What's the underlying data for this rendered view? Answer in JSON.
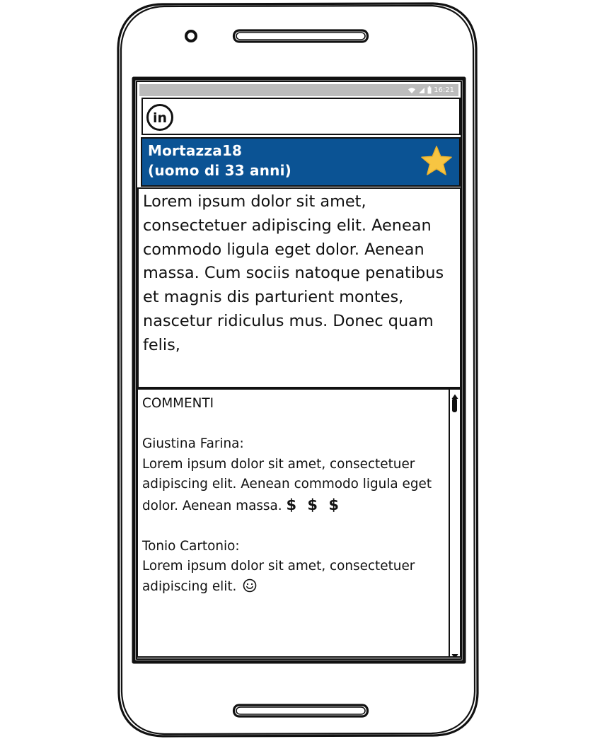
{
  "status_bar": {
    "time": "16:21"
  },
  "header": {
    "logo_icon": "linkedin-icon"
  },
  "profile": {
    "name": "Mortazza18",
    "subtitle": "(uomo di 33 anni)",
    "favorite_icon": "star-icon",
    "background_color": "#0b5394",
    "star_color": "#f7c542"
  },
  "post": {
    "text": "Lorem ipsum dolor sit amet, consectetuer adipiscing elit. Aenean commodo ligula eget dolor. Aenean massa. Cum sociis natoque penatibus et magnis dis parturient montes, nascetur ridiculus mus. Donec quam felis,"
  },
  "comments": {
    "title": "COMMENTI",
    "items": [
      {
        "author": "Giustina Farina:",
        "text": "Lorem ipsum dolor sit amet, consectetuer adipiscing elit. Aenean commodo ligula eget dolor. Aenean massa.",
        "extra": "$ $ $"
      },
      {
        "author": "Tonio Cartonio:",
        "text": "Lorem ipsum dolor sit amet, consectetuer adipiscing elit.",
        "extra_icon": "smiley-icon"
      }
    ]
  }
}
